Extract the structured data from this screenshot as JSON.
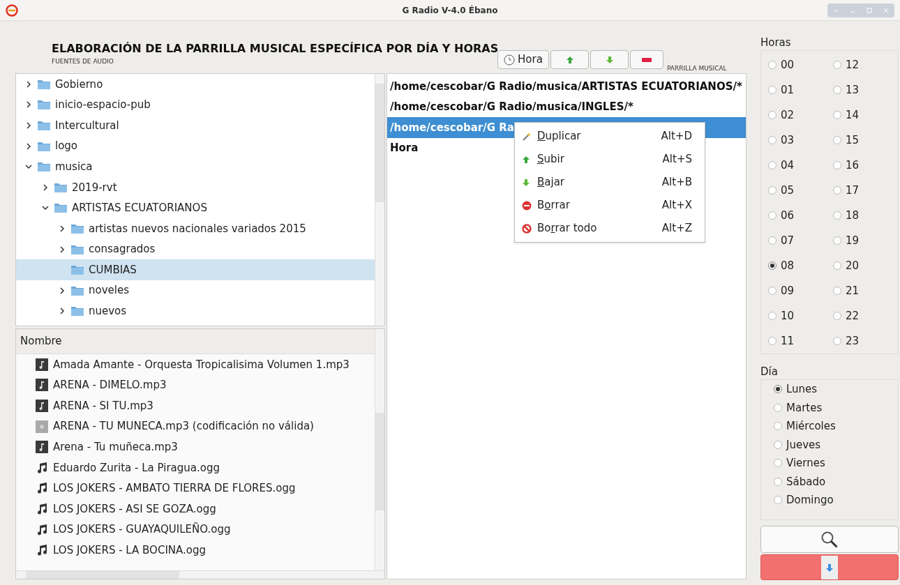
{
  "window": {
    "title": "G Radio V-4.0 Ébano"
  },
  "heading": "ELABORACIÓN DE LA PARRILLA MUSICAL ESPECÍFICA POR DÍA Y HORAS",
  "sources_label": "FUENTES DE AUDIO",
  "toolbar": {
    "hour_button": "Hora"
  },
  "playlist_label": "PARRILLA MUSICAL",
  "tree": [
    {
      "label": "Gobierno",
      "expanded": false,
      "selected": false
    },
    {
      "label": "inicio-espacio-pub",
      "expanded": false,
      "selected": false
    },
    {
      "label": "Intercultural",
      "expanded": false,
      "selected": false
    },
    {
      "label": "logo",
      "expanded": false,
      "selected": false
    },
    {
      "label": "musica",
      "expanded": true,
      "selected": false,
      "children": [
        {
          "label": "2019-rvt",
          "expanded": false,
          "selected": false
        },
        {
          "label": "ARTISTAS ECUATORIANOS",
          "expanded": true,
          "selected": false,
          "children": [
            {
              "label": "artistas nuevos nacionales variados 2015",
              "expanded": false,
              "selected": false
            },
            {
              "label": "consagrados",
              "expanded": false,
              "selected": false
            },
            {
              "label": "CUMBIAS",
              "expanded": false,
              "selected": true,
              "expandable": false
            },
            {
              "label": "noveles",
              "expanded": false,
              "selected": false
            },
            {
              "label": "nuevos",
              "expanded": false,
              "selected": false
            }
          ]
        }
      ]
    }
  ],
  "files": {
    "header": "Nombre",
    "rows": [
      {
        "name": "Amada Amante - Orquesta Tropicalisima Volumen 1.mp3",
        "kind": "mp3"
      },
      {
        "name": "ARENA - DIMELO.mp3",
        "kind": "mp3"
      },
      {
        "name": "ARENA - SI TU.mp3",
        "kind": "mp3"
      },
      {
        "name": "ARENA - TU MUNECA.mp3 (codificación no válida)",
        "kind": "invalid"
      },
      {
        "name": "Arena - Tu muñeca.mp3",
        "kind": "mp3"
      },
      {
        "name": "Eduardo Zurita - La Piragua.ogg",
        "kind": "ogg"
      },
      {
        "name": "LOS JOKERS - AMBATO TIERRA DE FLORES.ogg",
        "kind": "ogg"
      },
      {
        "name": "LOS JOKERS - ASI SE GOZA.ogg",
        "kind": "ogg"
      },
      {
        "name": "LOS JOKERS - GUAYAQUILEÑO.ogg",
        "kind": "ogg"
      },
      {
        "name": "LOS JOKERS - LA BOCINA.ogg",
        "kind": "ogg"
      }
    ]
  },
  "playlist": [
    {
      "text": "/home/cescobar/G Radio/musica/ARTISTAS ECUATORIANOS/*",
      "selected": false
    },
    {
      "text": "/home/cescobar/G Radio/musica/INGLES/*",
      "selected": false
    },
    {
      "text": "/home/cescobar/G Ra",
      "selected": true
    },
    {
      "text": "Hora",
      "selected": false
    }
  ],
  "context_menu": [
    {
      "kind": "duplicate",
      "key": "D",
      "post": "uplicar",
      "shortcut": "Alt+D"
    },
    {
      "kind": "up",
      "key": "S",
      "post": "ubir",
      "shortcut": "Alt+S"
    },
    {
      "kind": "down",
      "key": "B",
      "post": "ajar",
      "shortcut": "Alt+B"
    },
    {
      "kind": "delete",
      "pre": "B",
      "key": "o",
      "post": "rrar",
      "shortcut": "Alt+X"
    },
    {
      "kind": "clear",
      "pre": "Bo",
      "key": "r",
      "post": "rar todo",
      "shortcut": "Alt+Z"
    }
  ],
  "hours": {
    "title": "Horas",
    "items": [
      {
        "label": "00",
        "selected": false
      },
      {
        "label": "12",
        "selected": false
      },
      {
        "label": "01",
        "selected": false
      },
      {
        "label": "13",
        "selected": false
      },
      {
        "label": "02",
        "selected": false
      },
      {
        "label": "14",
        "selected": false
      },
      {
        "label": "03",
        "selected": false
      },
      {
        "label": "15",
        "selected": false
      },
      {
        "label": "04",
        "selected": false
      },
      {
        "label": "16",
        "selected": false
      },
      {
        "label": "05",
        "selected": false
      },
      {
        "label": "17",
        "selected": false
      },
      {
        "label": "06",
        "selected": false
      },
      {
        "label": "18",
        "selected": false
      },
      {
        "label": "07",
        "selected": false
      },
      {
        "label": "19",
        "selected": false
      },
      {
        "label": "08",
        "selected": true
      },
      {
        "label": "20",
        "selected": false
      },
      {
        "label": "09",
        "selected": false
      },
      {
        "label": "21",
        "selected": false
      },
      {
        "label": "10",
        "selected": false
      },
      {
        "label": "22",
        "selected": false
      },
      {
        "label": "11",
        "selected": false
      },
      {
        "label": "23",
        "selected": false
      }
    ]
  },
  "days": {
    "title": "Día",
    "items": [
      {
        "label": "Lunes",
        "selected": true
      },
      {
        "label": "Martes",
        "selected": false
      },
      {
        "label": "Miércoles",
        "selected": false
      },
      {
        "label": "Jueves",
        "selected": false
      },
      {
        "label": "Viernes",
        "selected": false
      },
      {
        "label": "Sábado",
        "selected": false
      },
      {
        "label": "Domingo",
        "selected": false
      }
    ]
  }
}
